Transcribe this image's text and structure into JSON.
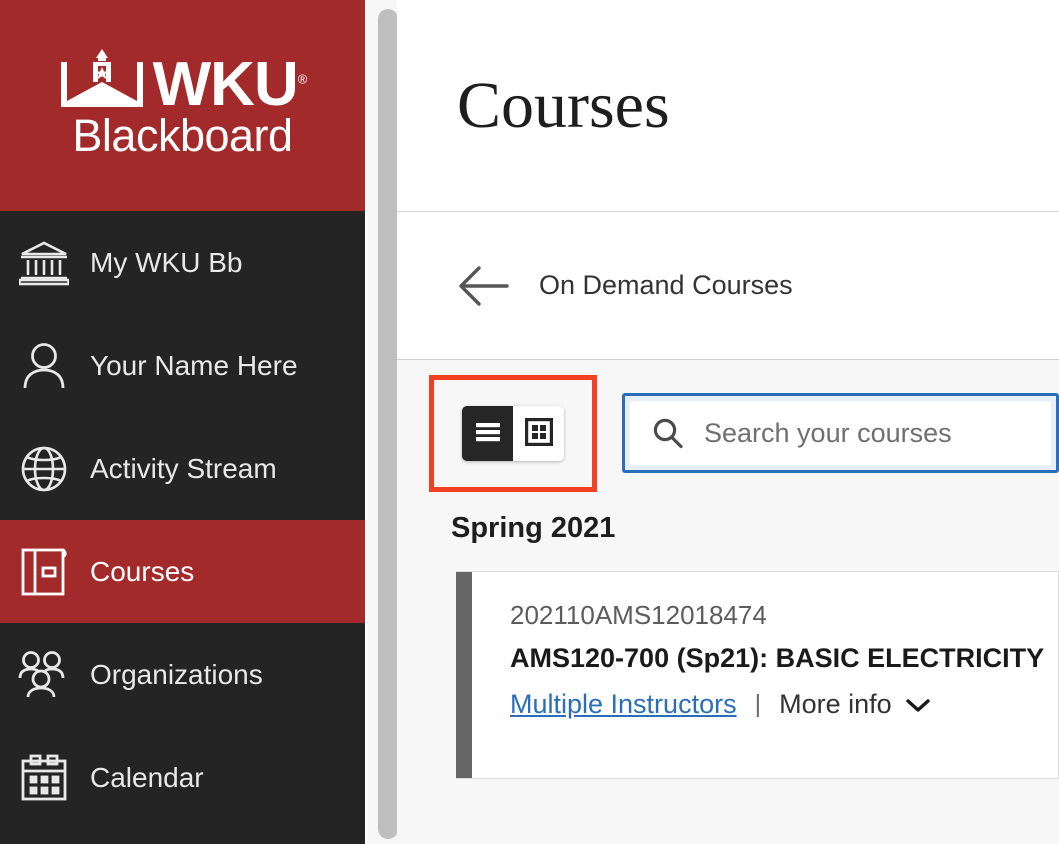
{
  "sidebar": {
    "logo": {
      "primary_text": "WKU",
      "registered_mark": "®",
      "secondary_text": "Blackboard",
      "background_color": "#a32a2a"
    },
    "items": [
      {
        "label": "My WKU Bb",
        "icon": "institution-icon",
        "active": false
      },
      {
        "label": "Your Name Here",
        "icon": "person-icon",
        "active": false
      },
      {
        "label": "Activity Stream",
        "icon": "globe-icon",
        "active": false
      },
      {
        "label": "Courses",
        "icon": "courses-book-icon",
        "active": true
      },
      {
        "label": "Organizations",
        "icon": "people-group-icon",
        "active": false
      },
      {
        "label": "Calendar",
        "icon": "calendar-icon",
        "active": false
      }
    ],
    "active_color": "#a32a2a",
    "background_color": "#242424"
  },
  "header": {
    "title": "Courses"
  },
  "breadcrumb": {
    "back_label": "On Demand Courses"
  },
  "toolbar": {
    "view_toggle": {
      "list_view_label": "List view",
      "grid_view_label": "Grid view",
      "selected": "list"
    },
    "annotation": {
      "color": "#f04124"
    },
    "search": {
      "placeholder": "Search your courses",
      "value": "",
      "focus_color": "#2a6ebb"
    }
  },
  "courses": {
    "term_heading": "Spring 2021",
    "items": [
      {
        "course_id": "202110AMS12018474",
        "title": "AMS120-700 (Sp21): BASIC ELECTRICITY",
        "instructors_label": "Multiple Instructors",
        "divider": "|",
        "more_info_label": "More info",
        "accent_color": "#666666"
      }
    ]
  }
}
